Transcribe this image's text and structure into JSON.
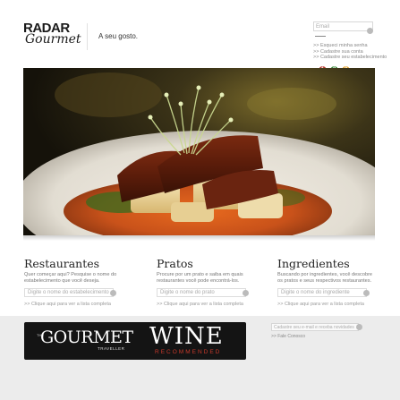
{
  "header": {
    "logo_top": "RADAR",
    "logo_bottom": "Gourmet",
    "tagline": "A seu gosto."
  },
  "login": {
    "email_placeholder": "Email",
    "links": [
      ">> Esqueci minha senha",
      ">> Cadastre sua conta",
      ">> Cadastre seu estabelecimento"
    ]
  },
  "badges": [
    "1",
    "2",
    "3"
  ],
  "columns": [
    {
      "title": "Restaurantes",
      "description": "Quer começar aqui? Pesquise o nome do estabelecimento que você deseja.",
      "placeholder": "Digite o nome do estabelecimento",
      "link": ">> Clique aqui para ver a lista completa"
    },
    {
      "title": "Pratos",
      "description": "Procure por um prato e saiba em quais restaurantes você pode encontrá-los.",
      "placeholder": "Digite o nome do prato",
      "link": ">> Clique aqui para ver a lista completa"
    },
    {
      "title": "Ingredientes",
      "description": "Buscando por ingredientes, você descobre os pratos e seus respectivos restaurantes.",
      "placeholder": "Digite o nome do ingrediente",
      "link": ">> Clique aqui para ver a lista completa"
    }
  ],
  "banner": {
    "the": "THE",
    "gourmet": "GOURMET",
    "traveller": "TRAVELLER",
    "wine": "WINE",
    "recommended": "RECOMMENDED"
  },
  "newsletter": {
    "placeholder": "Cadastre seu e-mail e receba novidades",
    "link": ">> Fale Conosco"
  },
  "colors": {
    "badge_red": "#b8352a",
    "badge_green": "#3a8a3a",
    "badge_yellow": "#e3a12a",
    "footer_bg": "#ececec"
  }
}
